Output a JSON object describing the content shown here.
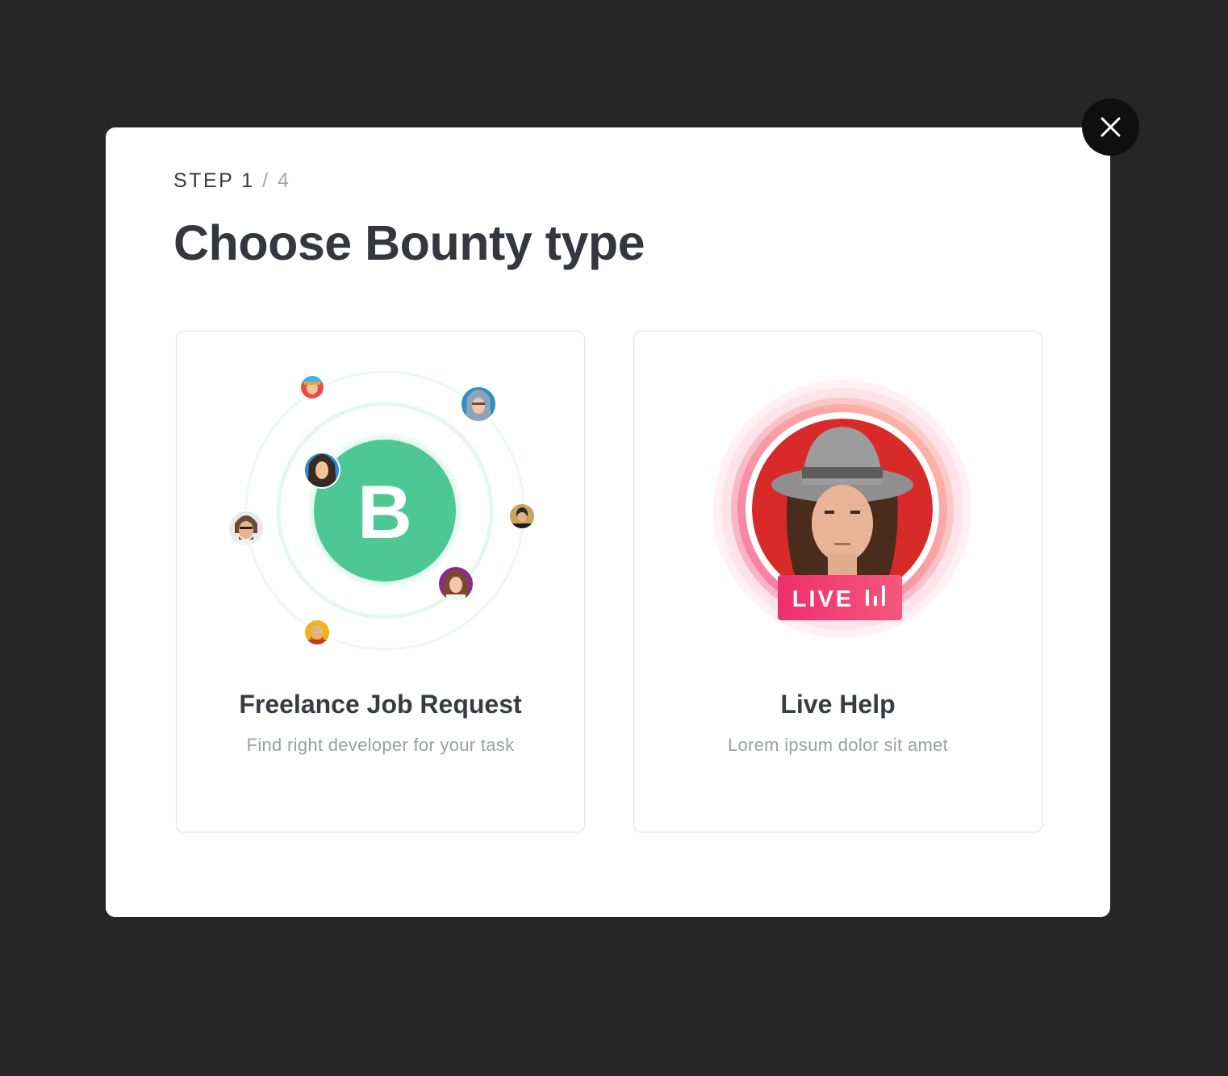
{
  "dialog": {
    "step_label": "STEP 1",
    "step_total": " / 4",
    "title": "Choose Bounty type",
    "close_icon": "close-icon"
  },
  "options": [
    {
      "title": "Freelance Job Request",
      "description": "Find right developer for your task",
      "logo_letter": "B",
      "accent": "#4dc895"
    },
    {
      "title": "Live Help",
      "description": "Lorem ipsum dolor sit amet",
      "badge": "LIVE",
      "accent": "#f03c6e"
    }
  ],
  "colors": {
    "backdrop": "#262626",
    "surface": "#ffffff",
    "heading": "#34373d",
    "muted": "#9a9ea4",
    "green": "#4dc895",
    "live_pink": "#f03c6e"
  }
}
